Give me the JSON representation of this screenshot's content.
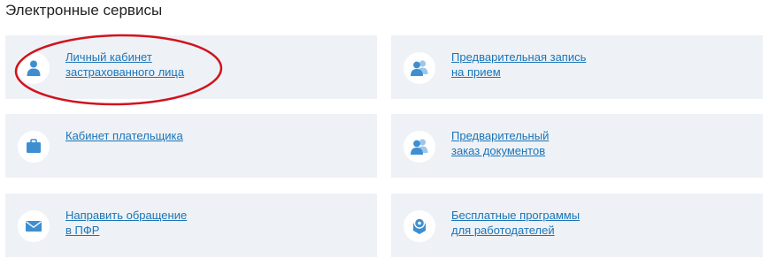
{
  "page": {
    "title": "Электронные сервисы"
  },
  "colors": {
    "card_background": "#eef2f6",
    "link": "#1a74b8",
    "icon": "#3d8fd1",
    "highlight_ellipse": "#d0141e"
  },
  "services": [
    {
      "icon": "person-icon",
      "line1": "Личный кабинет",
      "line2": "застрахованного лица"
    },
    {
      "icon": "people-group-icon",
      "line1": "Предварительная запись",
      "line2": "на прием"
    },
    {
      "icon": "briefcase-icon",
      "line1": "Кабинет плательщика",
      "line2": ""
    },
    {
      "icon": "people-group-icon",
      "line1": "Предварительный",
      "line2": "заказ документов"
    },
    {
      "icon": "envelope-icon",
      "line1": "Направить обращение",
      "line2": "в ПФР"
    },
    {
      "icon": "software-disc-icon",
      "line1": "Бесплатные программы",
      "line2": "для работодателей"
    }
  ]
}
